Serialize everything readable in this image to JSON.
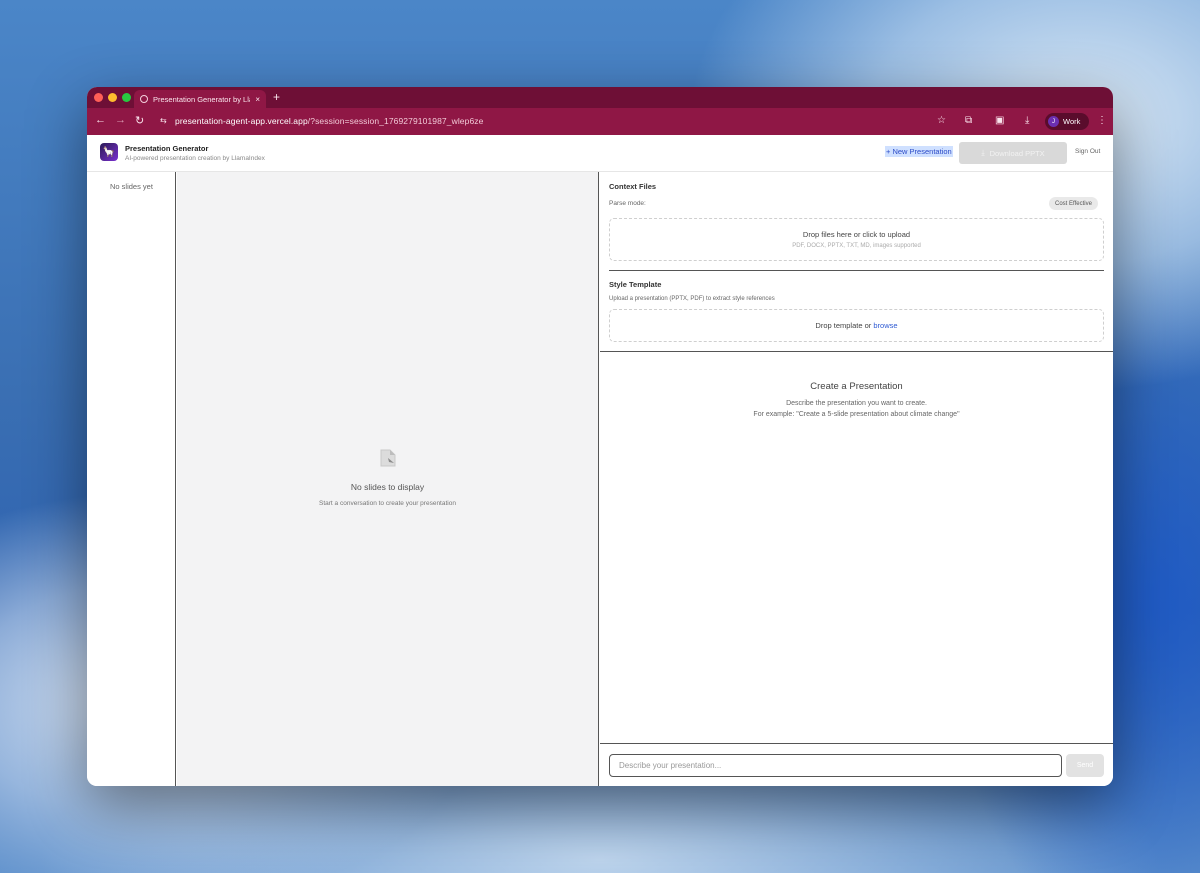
{
  "browser": {
    "tab_title": "Presentation Generator by Lla",
    "tab_close": "×",
    "new_tab": "+",
    "url_host": "presentation-agent-app.vercel.app",
    "url_rest": "/?session=session_1769279101987_wlep6ze",
    "profile_initial": "J",
    "profile_name": "Work",
    "back_icon": "arrow-left-icon",
    "forward_icon": "arrow-right-icon",
    "reload_icon": "reload-icon"
  },
  "header": {
    "title": "Presentation Generator",
    "subtitle": "AI-powered presentation creation by LlamaIndex",
    "new_presentation": "+ New Presentation",
    "download": "Download PPTX",
    "sign_out": "Sign Out"
  },
  "thumbnails": {
    "empty": "No slides yet"
  },
  "stage": {
    "empty_title": "No slides to display",
    "empty_sub": "Start a conversation to create your presentation"
  },
  "context": {
    "title": "Context Files",
    "parse_label": "Parse mode:",
    "parse_value": "Cost Effective",
    "drop_main": "Drop files here or click to upload",
    "drop_sub": "PDF, DOCX, PPTX, TXT, MD, images supported"
  },
  "style_template": {
    "title": "Style Template",
    "desc": "Upload a presentation (PPTX, PDF) to extract style references",
    "drop_prefix": "Drop template or ",
    "browse": "browse"
  },
  "chat": {
    "title": "Create a Presentation",
    "line1": "Describe the presentation you want to create.",
    "line2": "For example: \"Create a 5-slide presentation about climate change\"",
    "placeholder": "Describe your presentation...",
    "send": "Send"
  },
  "colors": {
    "browser_frame": "#8f1745",
    "accent_link": "#2f5bd3"
  }
}
